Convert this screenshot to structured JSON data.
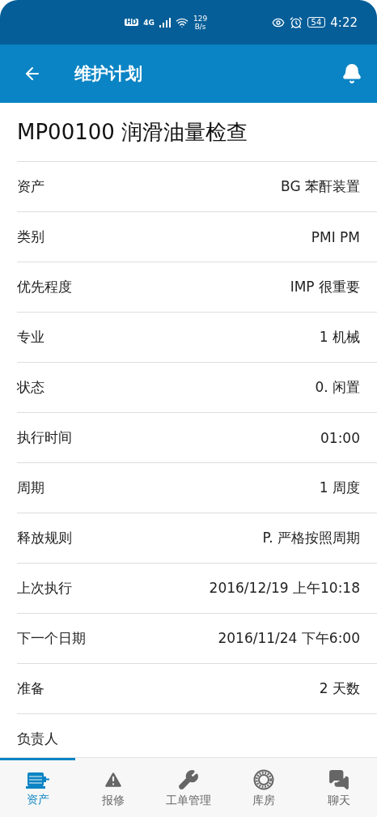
{
  "status_bar": {
    "hd": "HD",
    "network": "4G",
    "speed": "129",
    "speed_unit": "B/s",
    "battery": "54",
    "time": "4:22"
  },
  "app_bar": {
    "title": "维护计划"
  },
  "plan_title": "MP00100 润滑油量检查",
  "fields": [
    {
      "label": "资产",
      "value": "BG 苯酐装置"
    },
    {
      "label": "类别",
      "value": "PMI PM"
    },
    {
      "label": "优先程度",
      "value": "IMP 很重要"
    },
    {
      "label": "专业",
      "value": "1 机械"
    },
    {
      "label": "状态",
      "value": "0. 闲置"
    },
    {
      "label": "执行时间",
      "value": "01:00"
    },
    {
      "label": "周期",
      "value": "1 周度"
    },
    {
      "label": "释放规则",
      "value": "P. 严格按照周期"
    },
    {
      "label": "上次执行",
      "value": "2016/12/19 上午10:18"
    },
    {
      "label": "下一个日期",
      "value": "2016/11/24 下午6:00"
    },
    {
      "label": "准备",
      "value": "2 天数"
    },
    {
      "label": "负责人"
    }
  ],
  "tabs": [
    {
      "kind": "motor",
      "label": "资产",
      "selected": true
    },
    {
      "kind": "warning",
      "label": "报修",
      "selected": false
    },
    {
      "kind": "wrench",
      "label": "工单管理",
      "selected": false
    },
    {
      "kind": "bearing",
      "label": "库房",
      "selected": false
    },
    {
      "kind": "chat",
      "label": "聊天",
      "selected": false
    }
  ]
}
